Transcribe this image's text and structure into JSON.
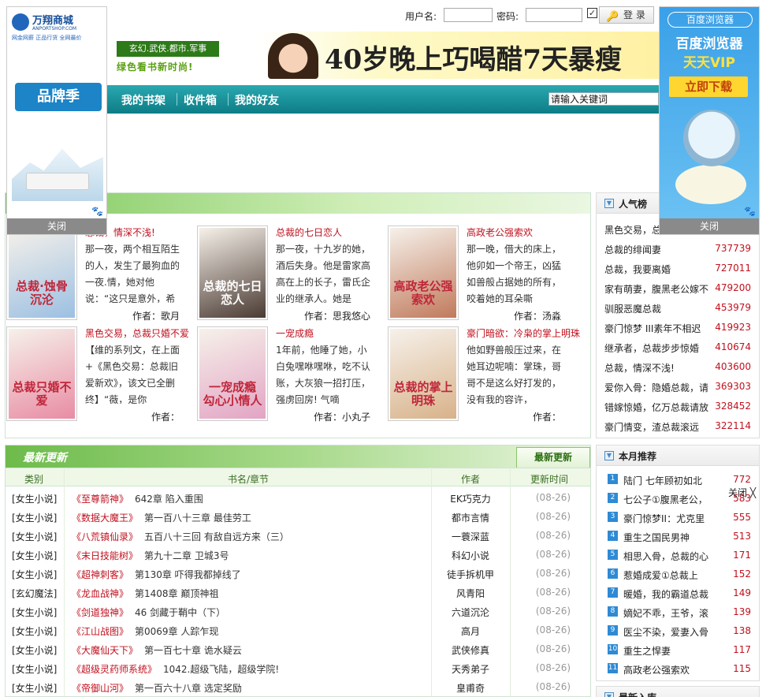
{
  "login": {
    "username_label": "用户名:",
    "password_label": "密码:",
    "remember": "✓",
    "login_button": "登 录"
  },
  "left_ad": {
    "brand_name": "万翔商城",
    "domain": "ANPORTSHOP.COM",
    "tagline": "网金网薪 正品行货 全网最价",
    "promo": "品牌季",
    "close": "关闭"
  },
  "right_ad": {
    "badge": "百度浏览器",
    "title": "百度浏览器",
    "subtitle": "天天VIP",
    "download": "立即下载",
    "close": "关闭"
  },
  "slogan": {
    "genres": "玄幻.武侠.都市.军事",
    "tag": "绿色看书新时尚!"
  },
  "banner_ad": {
    "text": "40岁晚上巧喝醋7天暴瘦"
  },
  "nav": {
    "items": [
      "我的书架",
      "收件箱",
      "我的好友"
    ],
    "search_placeholder": "请输入关键词"
  },
  "hot_books": [
    {
      "title": "总裁，情深不浅!",
      "desc": "那一夜，两个相互陌生的人，发生了最狗血的一夜.情，她对他说：“这只是意外，希",
      "author_label": "作者：",
      "author": "歌月",
      "cover_text": "总裁·蚀骨沉沦",
      "cover_color": "#9cc0e2"
    },
    {
      "title": "总裁的七日恋人",
      "desc": "那一夜，十九岁的她，酒后失身。他是雷家高高在上的长子，雷氏企业的继承人。她是",
      "author_label": "作者：",
      "author": "思我悠心",
      "cover_text": "总裁的七日恋人",
      "cover_color": "#4a3a32"
    },
    {
      "title": "高政老公强索欢",
      "desc": "那一晚，借大的床上，他卯如一个帝王，凶猛如兽般占据她的所有，咬着她的耳朵嘶",
      "author_label": "作者：",
      "author": "汤淼",
      "cover_text": "高政老公强索欢",
      "cover_color": "#c07a5c"
    },
    {
      "title": "黑色交易，总裁只婚不爱",
      "desc": "【维的系列文，在上面+《黑色交易：总裁旧爱新欢》，该文已全删终】“薇，是你",
      "author_label": "作者：",
      "author": "",
      "cover_text": "总裁只婚不爱",
      "cover_color": "#e88ca4"
    },
    {
      "title": "一宠成瘾",
      "desc": "1年前，他睡了她，小白兔嘿咻嘿咻，吃不认账，大灰狼一招打压，强虏回房! 气嘀",
      "author_label": "作者：",
      "author": "小丸子",
      "cover_text": "一宠成瘾 勾心小情人",
      "cover_color": "#e2a4c4"
    },
    {
      "title": "豪门暗欲：冷枭的掌上明珠",
      "desc": "他如野兽般压过来，在她耳边呢喃：掌珠，哥哥不是这么好打发的，没有我的容许，",
      "author_label": "作者：",
      "author": "",
      "cover_text": "总裁的掌上明珠",
      "cover_color": "#d8b28a"
    }
  ],
  "updates": {
    "title": "最新更新",
    "tab": "最新更新",
    "headers": [
      "类别",
      "书名/章节",
      "作者",
      "更新时间"
    ],
    "rows": [
      {
        "cat": "[女生小说]",
        "book": "《至尊箭神》",
        "chapter": "642章 陷入重围",
        "author": "EK巧克力",
        "time": "(08-26)"
      },
      {
        "cat": "[女生小说]",
        "book": "《数据大魔王》",
        "chapter": "第一百八十三章 最佳劳工",
        "author": "都市言情",
        "time": "(08-26)"
      },
      {
        "cat": "[女生小说]",
        "book": "《八荒镇仙录》",
        "chapter": "五百八十三回 有敌自远方来（三）",
        "author": "一蓑深蓝",
        "time": "(08-26)"
      },
      {
        "cat": "[女生小说]",
        "book": "《末日技能树》",
        "chapter": "第九十二章 卫城3号",
        "author": "科幻小说",
        "time": "(08-26)"
      },
      {
        "cat": "[女生小说]",
        "book": "《超神刺客》",
        "chapter": "第130章 吓得我都掉线了",
        "author": "徒手拆机甲",
        "time": "(08-26)"
      },
      {
        "cat": "[玄幻魔法]",
        "book": "《龙血战神》",
        "chapter": "第1408章 巅顶神祖",
        "author": "风青阳",
        "time": "(08-26)"
      },
      {
        "cat": "[女生小说]",
        "book": "《剑道独神》",
        "chapter": "46 剑藏于鞘中（下）",
        "author": "六道沉沦",
        "time": "(08-26)"
      },
      {
        "cat": "[女生小说]",
        "book": "《江山战图》",
        "chapter": "第0069章 人踪乍现",
        "author": "高月",
        "time": "(08-26)"
      },
      {
        "cat": "[女生小说]",
        "book": "《大魔仙天下》",
        "chapter": "第一百七十章 诡水疑云",
        "author": "武侠修真",
        "time": "(08-26)"
      },
      {
        "cat": "[女生小说]",
        "book": "《超级灵药师系统》",
        "chapter": "1042.超级飞陆，超级学院!",
        "author": "天秀弟子",
        "time": "(08-26)"
      },
      {
        "cat": "[女生小说]",
        "book": "《帝御山河》",
        "chapter": "第一百六十八章 选定奖励",
        "author": "皇甫奇",
        "time": "(08-26)"
      }
    ]
  },
  "popular": {
    "title": "人气榜",
    "items": [
      {
        "name": "黑色交易，总",
        "value": ""
      },
      {
        "name": "总裁的绯闻妻",
        "value": "737739"
      },
      {
        "name": "总裁，我要离婚",
        "value": "727011"
      },
      {
        "name": "家有萌妻，腹黑老公嫁不",
        "value": "479200"
      },
      {
        "name": "驯服恶魔总裁",
        "value": "453979"
      },
      {
        "name": "豪门惊梦 III素年不相迟",
        "value": "419923"
      },
      {
        "name": "继承者，总裁步步惊婚",
        "value": "410674"
      },
      {
        "name": "总裁，情深不浅!",
        "value": "403600"
      },
      {
        "name": "爱你入骨：隐婚总裁，请",
        "value": "369303"
      },
      {
        "name": "错嫁惊婚，亿万总裁请放",
        "value": "328452"
      },
      {
        "name": "豪门情变，渣总裁滚远",
        "value": "322114"
      }
    ]
  },
  "monthly": {
    "title": "本月推荐",
    "close": "关闭 ╳",
    "items": [
      {
        "rank": "1",
        "name": "陆门 七年顾初如北",
        "value": "772"
      },
      {
        "rank": "2",
        "name": "七公子①腹黑老公，",
        "value": "583"
      },
      {
        "rank": "3",
        "name": "豪门惊梦II：尤克里",
        "value": "555"
      },
      {
        "rank": "4",
        "name": "重生之国民男神",
        "value": "513"
      },
      {
        "rank": "5",
        "name": "相思入骨，总裁的心",
        "value": "171"
      },
      {
        "rank": "6",
        "name": "惹婚成爱①总裁上",
        "value": "152"
      },
      {
        "rank": "7",
        "name": "暖婚，我的霸道总裁",
        "value": "149"
      },
      {
        "rank": "8",
        "name": "嫡妃不乖，王爷，滚",
        "value": "139"
      },
      {
        "rank": "9",
        "name": "医尘不染，爱妻入骨",
        "value": "138"
      },
      {
        "rank": "10",
        "name": "重生之悍妻",
        "value": "117"
      },
      {
        "rank": "11",
        "name": "高政老公强索欢",
        "value": "115"
      }
    ]
  },
  "latest_stock": {
    "title": "最新入库"
  }
}
